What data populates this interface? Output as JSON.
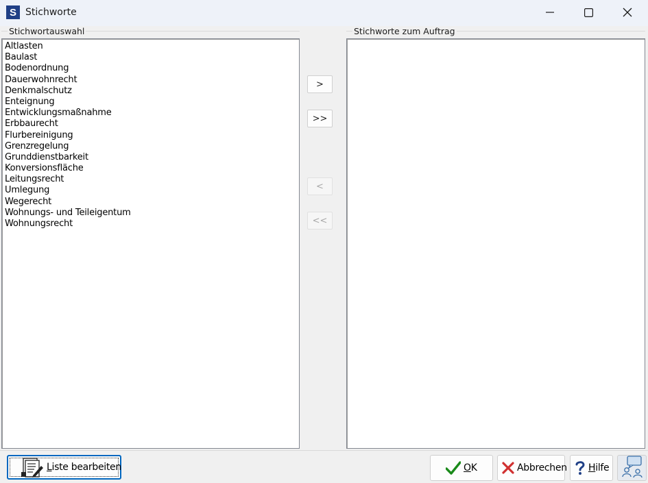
{
  "window": {
    "title": "Stichworte",
    "logo_letter": "S"
  },
  "left_group": {
    "label": "Stichwortauswahl",
    "items": [
      "Altlasten",
      "Baulast",
      "Bodenordnung",
      "Dauerwohnrecht",
      "Denkmalschutz",
      "Enteignung",
      "Entwicklungsmaßnahme",
      "Erbbaurecht",
      "Flurbereinigung",
      "Grenzregelung",
      "Grunddienstbarkeit",
      "Konversionsfläche",
      "Leitungsrecht",
      "Umlegung",
      "Wegerecht",
      "Wohnungs- und Teileigentum",
      "Wohnungsrecht"
    ]
  },
  "right_group": {
    "label": "Stichworte zum Auftrag",
    "items": []
  },
  "transfer": {
    "add": ">",
    "add_all": ">>",
    "remove": "<",
    "remove_all": "<<"
  },
  "buttons": {
    "liste_first": "L",
    "liste_rest": "iste bearbeiten",
    "ok_first": "O",
    "ok_rest": "K",
    "abbrechen": "Abbrechen",
    "hilfe_first": "H",
    "hilfe_rest": "ilfe"
  },
  "colors": {
    "logo_bg": "#1f3f86",
    "ok_check": "#1a8a1a",
    "cancel_x": "#d03030",
    "help_q": "#1f3f86",
    "focus_border": "#0067c0"
  },
  "icons": {
    "window_logo": "app-logo-icon",
    "minimize": "minimize-icon",
    "maximize": "maximize-icon",
    "close": "close-icon",
    "liste": "edit-list-icon",
    "ok": "checkmark-icon",
    "abbrechen": "cancel-x-icon",
    "hilfe": "question-icon",
    "extra": "support-chat-icon"
  }
}
